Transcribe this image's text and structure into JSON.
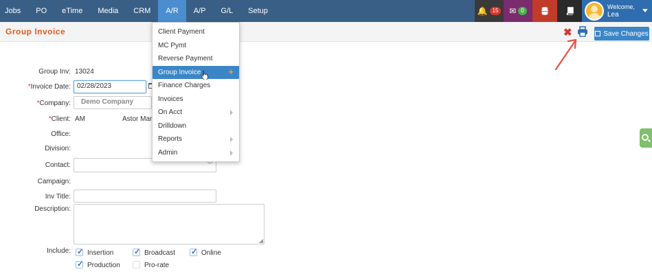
{
  "nav": {
    "items": [
      "Jobs",
      "PO",
      "eTime",
      "Media",
      "CRM",
      "A/R",
      "A/P",
      "G/L",
      "Setup"
    ],
    "active": "A/R"
  },
  "top_right": {
    "notifications_count": "15",
    "messages_count": "0",
    "welcome_label": "Welcome,",
    "user_name": "Lea",
    "colors": {
      "notif_bg": "#3a3a3a",
      "msg_bg": "#7a2c6d",
      "db_bg": "#c23b2a",
      "book_bg": "#2a2a2a",
      "welcome_bg": "#2f6db0",
      "notif_badge": "#d8362a",
      "msg_badge": "#4caf50"
    }
  },
  "page": {
    "title": "Group Invoice",
    "save_label": "Save Changes"
  },
  "form": {
    "group_inv_label": "Group Inv:",
    "group_inv_value": "13024",
    "invoice_date_label": "Invoice Date:",
    "invoice_date_value": "02/28/2023",
    "company_label": "Company:",
    "company_value": "Demo Company",
    "client_label": "Client:",
    "client_code": "AM",
    "client_name": "Astor Man",
    "office_label": "Office:",
    "division_label": "Division:",
    "contact_label": "Contact:",
    "campaign_label": "Campaign:",
    "inv_title_label": "Inv Title:",
    "description_label": "Description:",
    "include_label": "Include:",
    "required_marker": "*",
    "include_options": [
      {
        "label": "Insertion",
        "checked": true
      },
      {
        "label": "Broadcast",
        "checked": true
      },
      {
        "label": "Online",
        "checked": true
      },
      {
        "label": "Production",
        "checked": true
      },
      {
        "label": "Pro-rate",
        "checked": false
      }
    ]
  },
  "ar_menu": {
    "items": [
      {
        "label": "Client Payment",
        "submenu": false
      },
      {
        "label": "MC Pymt",
        "submenu": false
      },
      {
        "label": "Reverse Payment",
        "submenu": false
      },
      {
        "label": "Group Invoice",
        "submenu": false,
        "highlighted": true
      },
      {
        "label": "Finance Charges",
        "submenu": false
      },
      {
        "label": "Invoices",
        "submenu": false
      },
      {
        "label": "On Acct",
        "submenu": true
      },
      {
        "label": "Drilldown",
        "submenu": false
      },
      {
        "label": "Reports",
        "submenu": true
      },
      {
        "label": "Admin",
        "submenu": true
      }
    ]
  }
}
